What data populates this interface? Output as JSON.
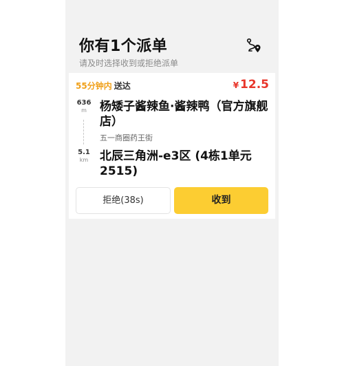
{
  "header": {
    "title": "你有1个派单",
    "subtitle": "请及时选择收到或拒绝派单",
    "route_icon": "route-map-pin-icon"
  },
  "order": {
    "eta_time": "55分钟内",
    "eta_label": "送达",
    "currency": "¥",
    "price": "12.5",
    "pickup": {
      "distance": "636",
      "unit": "m",
      "name": "杨矮子酱辣鱼·酱辣鸭（官方旗舰店）",
      "address": "五一商圈药王街"
    },
    "dropoff": {
      "distance": "5.1",
      "unit": "km",
      "name": "北辰三角洲-e3区 (4栋1单元2515)"
    }
  },
  "actions": {
    "reject_label": "拒绝(38s)",
    "accept_label": "收到"
  },
  "colors": {
    "accent_yellow": "#fccd32",
    "eta_orange": "#f0a019",
    "price_red": "#e8352a"
  }
}
